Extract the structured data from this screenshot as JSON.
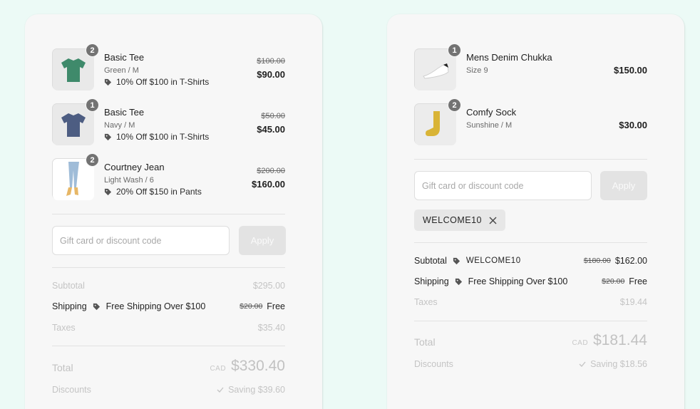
{
  "left": {
    "items": [
      {
        "name": "Basic Tee",
        "variant": "Green / M",
        "qty": "2",
        "discount": "10% Off $100 in T-Shirts",
        "original": "$100.00",
        "price": "$90.00",
        "image": "tshirt-green-icon"
      },
      {
        "name": "Basic Tee",
        "variant": "Navy / M",
        "qty": "1",
        "discount": "10% Off $100 in T-Shirts",
        "original": "$50.00",
        "price": "$45.00",
        "image": "tshirt-navy-icon"
      },
      {
        "name": "Courtney Jean",
        "variant": "Light Wash / 6",
        "qty": "2",
        "discount": "20% Off $150 in Pants",
        "original": "$200.00",
        "price": "$160.00",
        "image": "jeans-icon"
      }
    ],
    "code_placeholder": "Gift card or discount code",
    "apply_label": "Apply",
    "subtotal": {
      "label": "Subtotal",
      "value": "$295.00"
    },
    "shipping": {
      "label": "Shipping",
      "discount": "Free Shipping Over $100",
      "original": "$20.00",
      "value": "Free"
    },
    "taxes": {
      "label": "Taxes",
      "value": "$35.40"
    },
    "total": {
      "label": "Total",
      "currency": "CAD",
      "value": "$330.40"
    },
    "discounts": {
      "label": "Discounts",
      "value": "Saving $39.60"
    }
  },
  "right": {
    "items": [
      {
        "name": "Mens Denim Chukka",
        "variant": "Size 9",
        "qty": "1",
        "price": "$150.00",
        "image": "sneaker-icon"
      },
      {
        "name": "Comfy Sock",
        "variant": "Sunshine / M",
        "qty": "2",
        "price": "$30.00",
        "image": "sock-icon"
      }
    ],
    "code_placeholder": "Gift card or discount code",
    "apply_label": "Apply",
    "applied_code": "WELCOME10",
    "subtotal": {
      "label": "Subtotal",
      "discount": "WELCOME10",
      "original": "$180.00",
      "value": "$162.00"
    },
    "shipping": {
      "label": "Shipping",
      "discount": "Free Shipping Over $100",
      "original": "$20.00",
      "value": "Free"
    },
    "taxes": {
      "label": "Taxes",
      "value": "$19.44"
    },
    "total": {
      "label": "Total",
      "currency": "CAD",
      "value": "$181.44"
    },
    "discounts": {
      "label": "Discounts",
      "value": "Saving $18.56"
    }
  },
  "colors": {
    "background": "#ecfaf6",
    "panel": "#f7f7f7",
    "badge": "#737373",
    "tee_green": "#3f8a6b",
    "tee_navy": "#4d5d82",
    "sock": "#d9b436"
  }
}
